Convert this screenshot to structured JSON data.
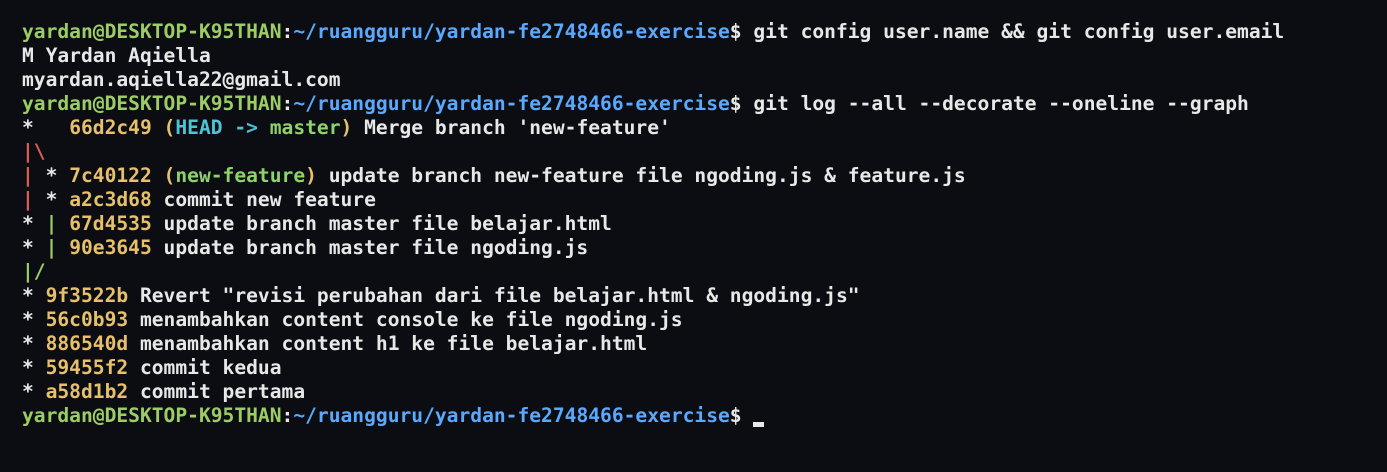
{
  "prompt": {
    "user_host": "yardan@DESKTOP-K95THAN",
    "colon": ":",
    "path": "~/ruangguru/yardan-fe2748466-exercise",
    "dollar": "$"
  },
  "commands": {
    "cmd1": " git config user.name && git config user.email",
    "cmd2": " git log --all --decorate --oneline --graph",
    "cmd3": " "
  },
  "output": {
    "user_name": "M Yardan Aqiella",
    "user_email": "myardan.aqiella22@gmail.com"
  },
  "log": [
    {
      "graph": "*   ",
      "hash": "66d2c49",
      "refs_open": " (",
      "head": "HEAD -> ",
      "branch": "master",
      "refs_close": ")",
      "message": " Merge branch 'new-feature'"
    },
    {
      "graph": "|\\"
    },
    {
      "graph_a": "|",
      "graph_b": " * ",
      "hash": "7c40122",
      "refs_open": " (",
      "branch": "new-feature",
      "refs_close": ")",
      "message": " update branch new-feature file ngoding.js & feature.js"
    },
    {
      "graph_a": "|",
      "graph_b": " * ",
      "hash": "a2c3d68",
      "message": " commit new feature"
    },
    {
      "graph_a": "* ",
      "graph_b": "|",
      "graph_c": " ",
      "hash": "67d4535",
      "message": " update branch master file belajar.html"
    },
    {
      "graph_a": "* ",
      "graph_b": "|",
      "graph_c": " ",
      "hash": "90e3645",
      "message": " update branch master file ngoding.js"
    },
    {
      "graph": "|/"
    },
    {
      "graph": "* ",
      "hash": "9f3522b",
      "message": " Revert \"revisi perubahan dari file belajar.html & ngoding.js\""
    },
    {
      "graph": "* ",
      "hash": "56c0b93",
      "message": " menambahkan content console ke file ngoding.js"
    },
    {
      "graph": "* ",
      "hash": "886540d",
      "message": " menambahkan content h1 ke file belajar.html"
    },
    {
      "graph": "* ",
      "hash": "59455f2",
      "message": " commit kedua"
    },
    {
      "graph": "* ",
      "hash": "a58d1b2",
      "message": " commit pertama"
    }
  ],
  "colors": {
    "background": "#0c0d12",
    "user_host": "#9ccc65",
    "path": "#5aa9ff",
    "hash": "#e6c06a",
    "head": "#4fc3d6",
    "branch": "#8fd16a",
    "graph_red": "#e05a5a",
    "graph_green": "#9ccc65"
  }
}
